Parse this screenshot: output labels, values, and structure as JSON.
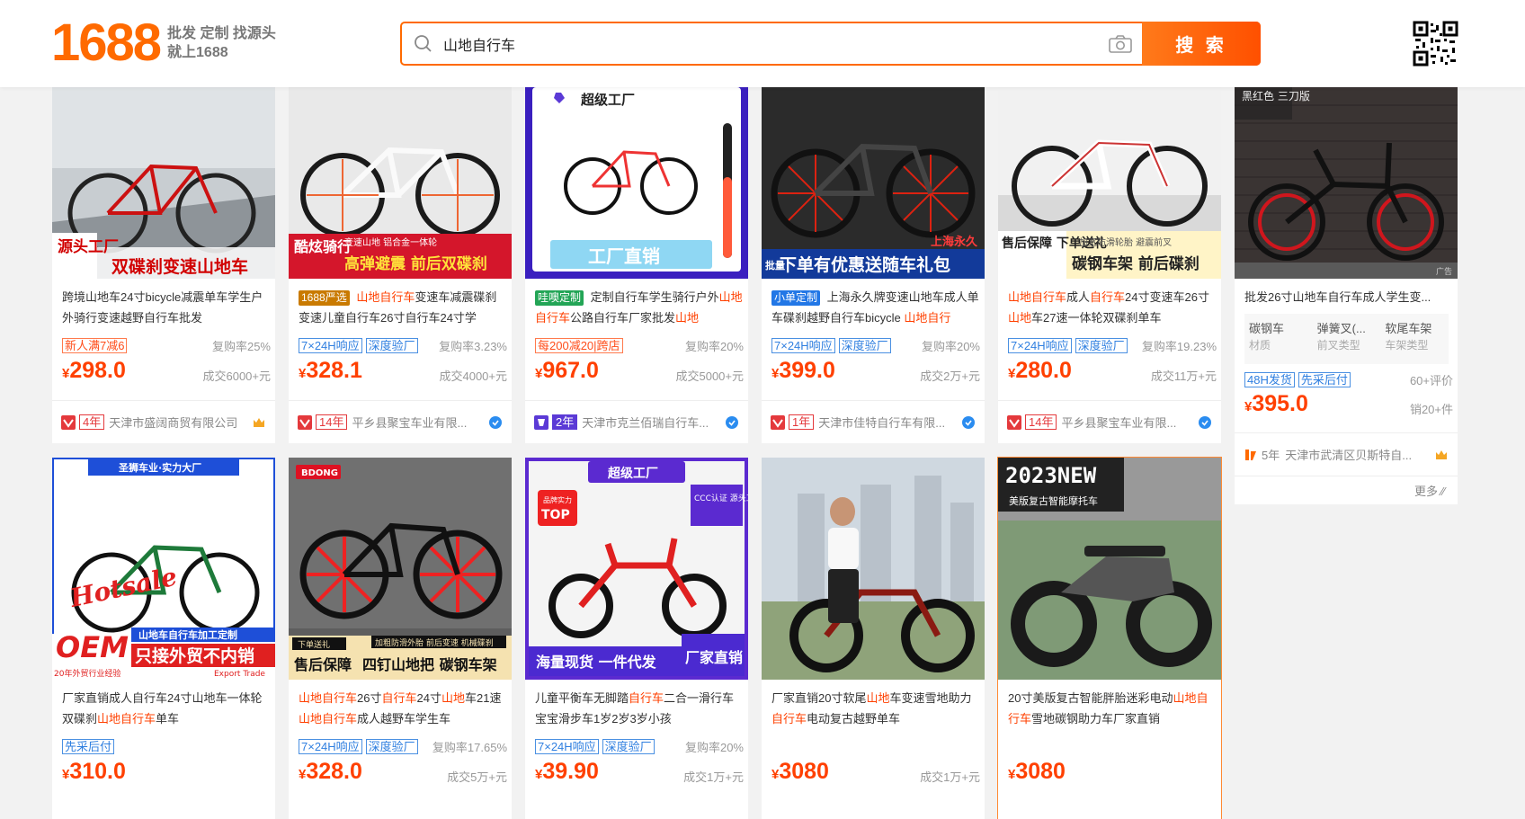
{
  "logo": {
    "number": "1688",
    "slogan_line1": "批发 定制 找源头",
    "slogan_line2": "就上1688"
  },
  "search": {
    "value": "山地自行车",
    "button_label": "搜 索"
  },
  "colors": {
    "brand": "#ff6a00",
    "price": "#ff4000",
    "tag_blue": "#2f7fe0"
  },
  "row1": [
    {
      "banner1": "源头工厂",
      "banner2": "双碟刹变速山地车",
      "title_plain": "跨境山地车24寸bicycle减震单车学生户外骑行变速越野自行车批发",
      "tag1": "新人满7减6",
      "rebuy": "复购率25%",
      "price_y": "¥",
      "price": "298.0",
      "deal": "成交6000+元",
      "years": "4年",
      "shop": "天津市盛阔商贸有限公司"
    },
    {
      "banner1": "酷炫骑行",
      "banner2": "高弹避震 前后双碟刹",
      "banner_sub": "变速山地 铝合金一体轮",
      "tag0": "1688严选",
      "t1": "山地自行车",
      "t2": "变速车减震碟刹变速儿童自行车26寸自行车24寸学",
      "tag1": "7×24H响应",
      "tag2": "深度验厂",
      "rebuy": "复购率3.23%",
      "price_y": "¥",
      "price": "328.1",
      "deal": "成交4000+元",
      "years": "14年",
      "shop": "平乡县聚宝车业有限..."
    },
    {
      "banner_top": "超级工厂",
      "banner2": "工厂直销",
      "tag0": "哇噢定制",
      "t1": "定制自行车学生骑行户外",
      "t2": "山地自行车",
      "t3": "公路自行车厂家批发",
      "t4": "山地",
      "tag1": "每200减20|跨店",
      "rebuy": "复购率20%",
      "price_y": "¥",
      "price": "967.0",
      "deal": "成交5000+元",
      "years": "2年",
      "shop": "天津市克兰佰瑞自行车..."
    },
    {
      "banner_corner": "上海永久",
      "banner2": "下单有优惠送随车礼包",
      "banner_left": "批量",
      "tag0": "小单定制",
      "t1": "上海永久牌变速山地车成人单车碟刹越野自行车bicycle ",
      "t2": "山地自行",
      "tag1": "7×24H响应",
      "tag2": "深度验厂",
      "rebuy": "复购率20%",
      "price_y": "¥",
      "price": "399.0",
      "deal": "成交2万+元",
      "years": "1年",
      "shop": "天津市佳特自行车有限..."
    },
    {
      "banner1": "售后保障 下单送礼",
      "banner2": "碳钢车架 前后碟刹",
      "banner_sub": "加宽防滑轮胎 避震前叉",
      "t1": "山地自行车",
      "t2": "成人",
      "t3": "自行车",
      "t4": "24寸变速车26寸",
      "t5": "山地",
      "t6": "车27速一体轮双碟刹单车",
      "tag1": "7×24H响应",
      "tag2": "深度验厂",
      "rebuy": "复购率19.23%",
      "price_y": "¥",
      "price": "280.0",
      "deal": "成交11万+元",
      "years": "14年",
      "shop": "平乡县聚宝车业有限..."
    },
    {
      "banner_top": "黑红色 三刀版",
      "ad": "广告",
      "title": "批发26寸山地车自行车成人学生变...",
      "attr1_v": "碳钢车",
      "attr1_k": "材质",
      "attr2_v": "弹簧叉(...",
      "attr2_k": "前叉类型",
      "attr3_v": "软尾车架",
      "attr3_k": "车架类型",
      "tag1": "48H发货",
      "tag2": "先采后付",
      "reviews": "60+评价",
      "price_y": "¥",
      "price": "395.0",
      "sales": "销20+件",
      "years": "5年",
      "shop": "天津市武清区贝斯特自..."
    }
  ],
  "row2": [
    {
      "banner_top": "圣狮车业·实力大厂",
      "banner_oem": "OEM",
      "banner2": "只接外贸不内销",
      "banner_sub": "山地车自行车加工定制",
      "banner_tiny": "20年外贸行业经验",
      "banner_en": "Export Trade",
      "t1": "厂家直销成人自行车24寸山地车一体轮双碟刹",
      "t2": "山地自行车",
      "t3": "单车",
      "tag1": "先采后付",
      "price_y": "¥",
      "price": "310.0"
    },
    {
      "banner_top": "BDONG",
      "banner1": "售后保障",
      "banner2": "四钉山地把 碳钢车架",
      "banner_sub": "加粗防滑外胎 前后变速 机械碟刹",
      "banner_tiny": "下单送礼",
      "t1": "山地自行车",
      "t2": "26寸",
      "t3": "自行车",
      "t4": "24寸",
      "t5": "山地",
      "t6": "车21速",
      "t7": "山地自行车",
      "t8": "成人越野车学生车",
      "tag1": "7×24H响应",
      "tag2": "深度验厂",
      "rebuy": "复购率17.65%",
      "price_y": "¥",
      "price": "328.0",
      "deal": "成交5万+元"
    },
    {
      "banner_top": "超级工厂",
      "banner_top2": "品牌实力",
      "banner_top3": "TOP",
      "banner_side": "CCC认证 源头工厂 闪电发货",
      "banner2": "海量现货 一件代发",
      "banner_corner": "厂家直销",
      "t1": "儿童平衡车无脚踏",
      "t2": "自行车",
      "t3": "二合一滑行车宝宝滑步车1岁2岁3岁小孩",
      "tag1": "7×24H响应",
      "tag2": "深度验厂",
      "rebuy": "复购率20%",
      "price_y": "¥",
      "price": "39.90",
      "deal": "成交1万+元"
    },
    {
      "t1": "厂家直销20寸软尾",
      "t2": "山地",
      "t3": "车变速雪地助力",
      "t4": "自行车",
      "t5": "电动复古越野单车",
      "price_y": "¥",
      "price": "3080",
      "deal": "成交1万+元"
    },
    {
      "banner_top": "2023NEW",
      "banner_sub": "美版复古智能摩托车",
      "t1": "20寸美版复古智能胖胎迷彩电动",
      "t2": "山地自行车",
      "t3": "雪地碳钢助力车厂家直销",
      "price_y": "¥",
      "price": "3080"
    }
  ],
  "more_label": "更多"
}
